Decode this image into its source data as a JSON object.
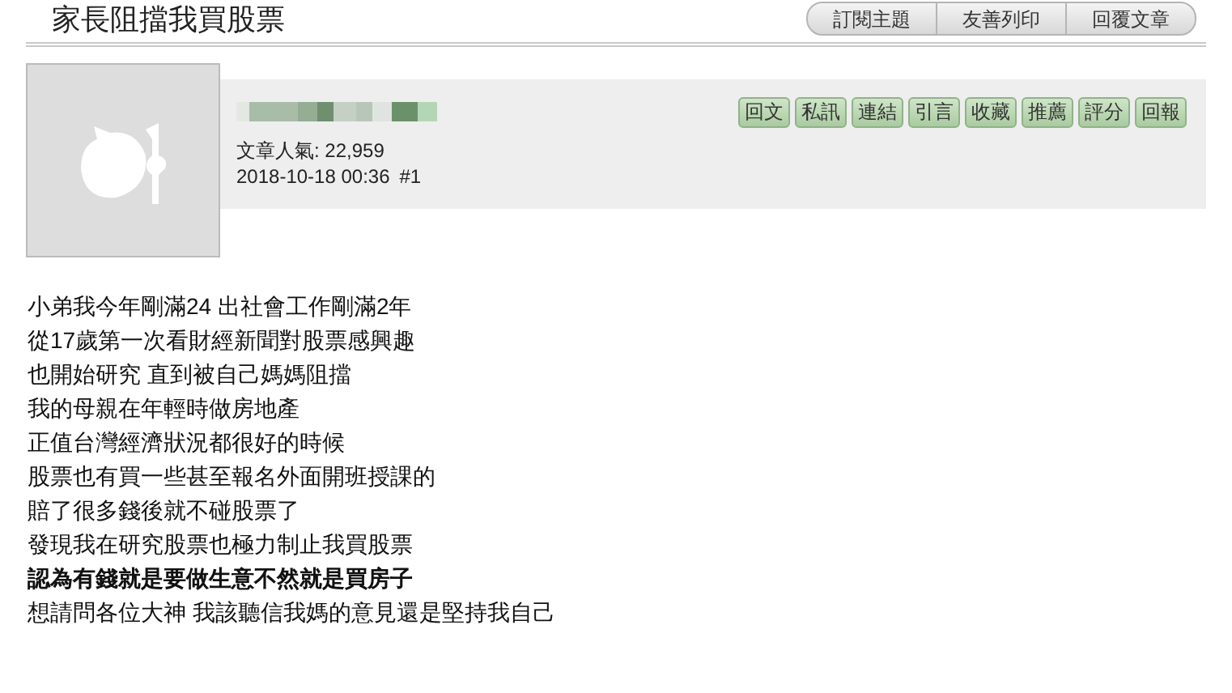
{
  "title": "家長阻擋我買股票",
  "top_buttons": [
    "訂閱主題",
    "友善列印",
    "回覆文章"
  ],
  "post": {
    "popularity": "文章人氣: 22,959",
    "date": "2018-10-18 00:36",
    "floor": "#1",
    "actions": [
      "回文",
      "私訊",
      "連結",
      "引言",
      "收藏",
      "推薦",
      "評分",
      "回報"
    ],
    "lines": [
      {
        "text": "小弟我今年剛滿24 出社會工作剛滿2年",
        "bold": false
      },
      {
        "text": "從17歲第一次看財經新聞對股票感興趣",
        "bold": false
      },
      {
        "text": "也開始研究 直到被自己媽媽阻擋",
        "bold": false
      },
      {
        "text": "我的母親在年輕時做房地產",
        "bold": false
      },
      {
        "text": "正值台灣經濟狀況都很好的時候",
        "bold": false
      },
      {
        "text": "股票也有買一些甚至報名外面開班授課的",
        "bold": false
      },
      {
        "text": "賠了很多錢後就不碰股票了",
        "bold": false
      },
      {
        "text": "發現我在研究股票也極力制止我買股票",
        "bold": false
      },
      {
        "text": "認為有錢就是要做生意不然就是買房子",
        "bold": true
      },
      {
        "text": "想請問各位大神 我該聽信我媽的意見還是堅持我自己",
        "bold": false
      }
    ]
  }
}
